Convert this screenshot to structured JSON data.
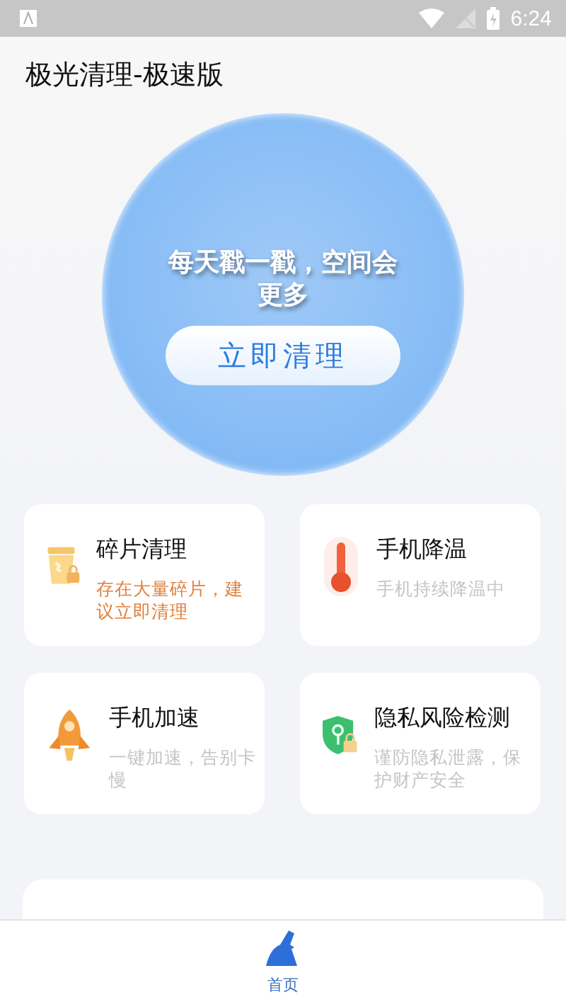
{
  "status_bar": {
    "time": "6:24"
  },
  "app_title": "极光清理-极速版",
  "hero": {
    "slogan": "每天戳一戳，空间会更多",
    "button": "立即清理"
  },
  "features": [
    {
      "title": "碎片清理",
      "tip": "存在大量碎片，建议立即清理",
      "highlight": true
    },
    {
      "title": "手机降温",
      "tip": "手机持续降温中",
      "highlight": false
    },
    {
      "title": "手机加速",
      "tip": "一键加速，告别卡慢",
      "highlight": false
    },
    {
      "title": "隐私风险检测",
      "tip": "谨防隐私泄露，保护财产安全",
      "highlight": false
    }
  ],
  "tabs": [
    {
      "label": "首页",
      "selected": true
    }
  ]
}
